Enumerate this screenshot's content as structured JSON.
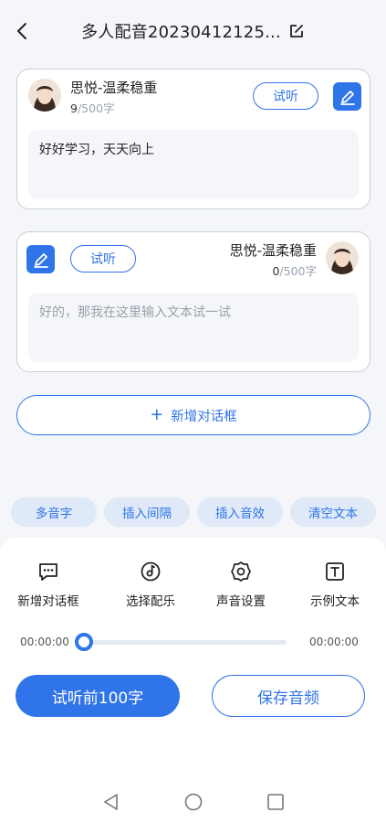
{
  "header": {
    "title": "多人配音20230412125...",
    "back_icon": "chevron-left-icon",
    "edit_icon": "edit-square-icon"
  },
  "dialogs": [
    {
      "voice_name": "思悦-温柔稳重",
      "count_current": "9",
      "count_max": "/500字",
      "listen_label": "试听",
      "text": "好好学习，天天向上"
    },
    {
      "voice_name": "思悦-温柔稳重",
      "count_current": "0",
      "count_max": "/500字",
      "listen_label": "试听",
      "placeholder": "好的，那我在这里输入文本试一试"
    }
  ],
  "add_dialog": {
    "plus": "+",
    "label": "新增对话框"
  },
  "chips": [
    "多音字",
    "插入间隔",
    "插入音效",
    "清空文本"
  ],
  "tools": [
    {
      "label": "新增对话框",
      "icon": "chat-bubble-icon"
    },
    {
      "label": "选择配乐",
      "icon": "music-disc-icon"
    },
    {
      "label": "声音设置",
      "icon": "gear-icon"
    },
    {
      "label": "示例文本",
      "icon": "text-box-icon"
    }
  ],
  "player": {
    "current_time": "00:00:00",
    "total_time": "00:00:00",
    "progress": 0
  },
  "actions": {
    "preview_label": "试听前100字",
    "save_label": "保存音频"
  },
  "colors": {
    "accent": "#2f74e8",
    "chip_bg": "#dfe9f7",
    "page_bg": "#f4f6fa"
  }
}
